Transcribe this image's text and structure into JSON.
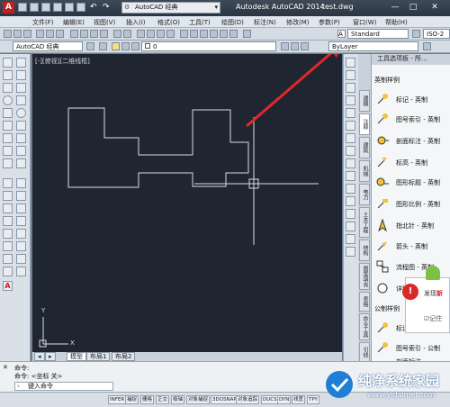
{
  "titlebar": {
    "workspace": "AutoCAD 经典",
    "app_title": "Autodesk AutoCAD 2014",
    "file_title": "test.dwg",
    "minimize": "—",
    "maximize": "□",
    "close": "✕"
  },
  "menu": [
    "文件(F)",
    "编辑(E)",
    "视图(V)",
    "插入(I)",
    "格式(O)",
    "工具(T)",
    "绘图(D)",
    "标注(N)",
    "修改(M)",
    "参数(P)",
    "窗口(W)",
    "帮助(H)"
  ],
  "toolbar2": {
    "workspace_combo": "AutoCAD 经典",
    "layer_value": "0",
    "text_style": "Standard",
    "dim_style": "ISO-2",
    "linetype": "ByLayer"
  },
  "canvas": {
    "view_label": "[-][俯视][二维线框]",
    "ucs_y": "Y",
    "ucs_x": "X"
  },
  "layout_tabs": [
    "模型",
    "布局1",
    "布局2"
  ],
  "palette": {
    "title": "工具选项板 - 所...",
    "section_imperial": "英制样例",
    "imperial_items": [
      "标记 - 英制",
      "图号索引 - 英制",
      "剖面标注 - 英制",
      "标高 - 英制",
      "图形标题 - 英制",
      "图形比例 - 英制",
      "指北针 - 英制",
      "箭头 - 英制",
      "流程图 - 英制",
      "详细..."
    ],
    "section_metric": "公制样例",
    "metric_items": [
      "标记 - 公制",
      "图号索引 - 公制",
      "剖面标注 - ..."
    ],
    "vtabs": [
      "建模",
      "注释",
      "建筑",
      "机械",
      "电力",
      "土木工程",
      "结构",
      "图案填充",
      "表格",
      "命令工具",
      "引线"
    ]
  },
  "notify": {
    "title": "发现",
    "highlight": "新",
    "checkbox": "记住"
  },
  "command": {
    "line1": "命令:",
    "line2": "命令: <坐标 关>",
    "placeholder": "键入命令"
  },
  "status_buttons": [
    "INFER",
    "捕捉",
    "栅格",
    "正交",
    "极轴",
    "对象捕捉",
    "3DOSNAP",
    "对象追踪",
    "DUCS",
    "DYN",
    "线宽",
    "TPY"
  ],
  "watermark": {
    "title": "纯净系统家园",
    "url": "www.yidaimei.com"
  },
  "colors": {
    "canvas_bg": "#1f2631",
    "arrow": "#e0282a",
    "drawing_line": "#d8dde4"
  }
}
